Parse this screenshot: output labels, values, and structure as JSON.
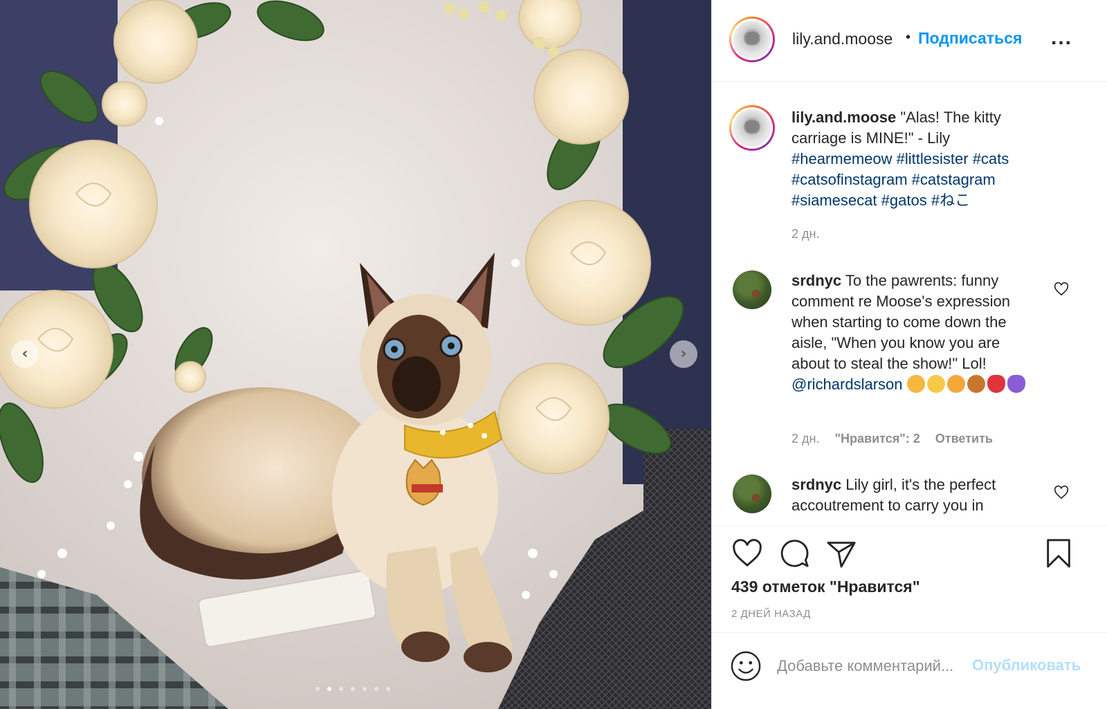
{
  "photo": {
    "alt_carousel": {
      "prev_icon": "chevron-left-icon",
      "next_icon": "chevron-right-icon"
    },
    "carousel": {
      "total": 7,
      "active_index": 1
    }
  },
  "header": {
    "username": "lily.and.moose",
    "separator": "•",
    "follow_label": "Подписаться",
    "more_label": "..."
  },
  "caption": {
    "username": "lily.and.moose",
    "text": "\"Alas! The kitty carriage is MINE!\" - Lily",
    "hashtags": [
      "#hearmemeow",
      "#littlesister",
      "#cats",
      "#catsofinstagram",
      "#catstagram",
      "#siamesecat",
      "#gatos",
      "#ねこ"
    ],
    "time": "2 дн."
  },
  "comments": [
    {
      "username": "srdnyc",
      "text": "To the pawrents: funny comment re Moose's expression when starting to come down the aisle, \"When you know you are about to steal the show!\" Lol!",
      "mention": "@richardslarson",
      "time": "2 дн.",
      "likes": "\"Нравится\": 2",
      "reply": "Ответить"
    },
    {
      "username": "srdnyc",
      "text": "Lily girl, it's the perfect accoutrement to carry you in"
    }
  ],
  "actions": {
    "likes_count": "439 отметок \"Нравится\"",
    "date": "2 ДНЕЙ НАЗАД"
  },
  "add_comment": {
    "placeholder": "Добавьте комментарий...",
    "publish_label": "Опубликовать"
  },
  "colors": {
    "accent": "#0095f6",
    "hashtag": "#00376b",
    "muted": "#8e8e8e",
    "publish_disabled": "#b2dffc"
  }
}
